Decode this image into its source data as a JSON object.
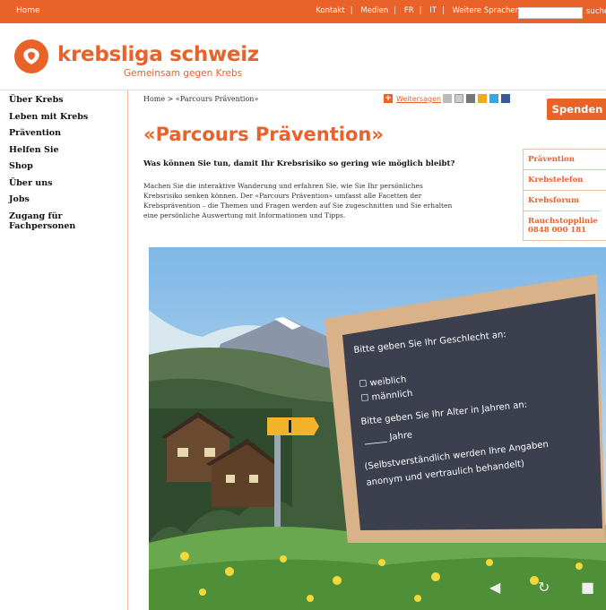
{
  "topbar": {
    "home": "Home",
    "nav": [
      "Kontakt",
      "Medien",
      "FR",
      "IT",
      "Weitere Sprachen"
    ],
    "search_label": "suche"
  },
  "header": {
    "logo_name": "krebsliga schweiz",
    "logo_tagline": "Gemeinsam gegen Krebs"
  },
  "leftnav": [
    "Über Krebs",
    "Leben mit Krebs",
    "Prävention",
    "Helfen Sie",
    "Shop",
    "Über uns",
    "Jobs",
    "Zugang für Fachpersonen"
  ],
  "breadcrumb": "Home > «Parcours Prävention»",
  "share": {
    "label": "Weitersagen"
  },
  "donate": "Spenden",
  "main": {
    "title": "«Parcours Prävention»",
    "subhead": "Was können Sie tun, damit Ihr Krebsrisiko so gering wie möglich bleibt?",
    "body": "Machen Sie die interaktive Wanderung und erfahren Sie, wie Sie Ihr persönliches Krebsrisiko senken können. Der «Parcours Prävention» umfasst alle Facetten der Krebsprävention – die Themen und Fragen werden auf Sie zugeschnitten und Sie erhalten eine persönliche Auswertung mit Informationen und Tipps."
  },
  "sidebar": [
    "Prävention",
    "Krebstelefon",
    "Krebsforum",
    "Rauchstopplinie 0848 000 181"
  ],
  "board": {
    "q1": "Bitte geben Sie Ihr Geschlecht an:",
    "opt1": "weiblich",
    "opt2": "männlich",
    "q2": "Bitte geben Sie Ihr Alter in Jahren an:",
    "years": "Jahre",
    "note1": "(Selbstverständlich werden Ihre Angaben",
    "note2": "anonym und vertraulich behandelt)"
  },
  "colors": {
    "brand": "#e8622a",
    "board": "#3b3f4e",
    "frame": "#d9b28a"
  }
}
